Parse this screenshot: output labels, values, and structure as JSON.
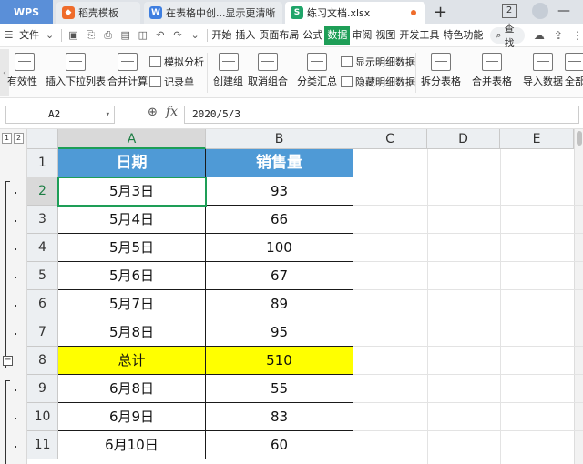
{
  "tabs": {
    "app": "WPS",
    "items": [
      {
        "label": "稻壳模板",
        "icon": "docer-icon"
      },
      {
        "label": "在表格中创...显示更清晰",
        "icon": "writer-doc-icon"
      },
      {
        "label": "练习文档.xlsx",
        "icon": "spreadsheet-icon"
      }
    ],
    "new_tab": "+",
    "window_count": "2"
  },
  "menu": {
    "file": "文件",
    "items": [
      "开始",
      "插入",
      "页面布局",
      "公式",
      "数据",
      "审阅",
      "视图",
      "开发工具",
      "特色功能"
    ],
    "active": "数据",
    "search": "查找"
  },
  "ribbon": {
    "validity": "有效性",
    "insert_dropdown": "插入下拉列表",
    "merge_calc": "合并计算",
    "simulate": "模拟分析",
    "record": "记录单",
    "create_group": "创建组",
    "ungroup": "取消组合",
    "subtotal": "分类汇总",
    "show_detail": "显示明细数据",
    "hide_detail": "隐藏明细数据",
    "split_table": "拆分表格",
    "merge_table": "合并表格",
    "import_data": "导入数据",
    "all": "全部"
  },
  "formula_bar": {
    "cell_ref": "A2",
    "fx": "fx",
    "value": "2020/5/3"
  },
  "sheet": {
    "outline_levels": [
      "1",
      "2"
    ],
    "columns": [
      "A",
      "B",
      "C",
      "D",
      "E"
    ],
    "rows": [
      "1",
      "2",
      "3",
      "4",
      "5",
      "6",
      "7",
      "8",
      "9",
      "10",
      "11"
    ],
    "header": {
      "date": "日期",
      "sales": "销售量"
    },
    "data": [
      {
        "date": "5月3日",
        "sales": "93"
      },
      {
        "date": "5月4日",
        "sales": "66"
      },
      {
        "date": "5月5日",
        "sales": "100"
      },
      {
        "date": "5月6日",
        "sales": "67"
      },
      {
        "date": "5月7日",
        "sales": "89"
      },
      {
        "date": "5月8日",
        "sales": "95"
      },
      {
        "date": "总计",
        "sales": "510"
      },
      {
        "date": "6月8日",
        "sales": "55"
      },
      {
        "date": "6月9日",
        "sales": "83"
      },
      {
        "date": "6月10日",
        "sales": "60"
      }
    ],
    "total_color": "#ffff00",
    "header_color": "#4f9ad6",
    "accent": "#1e9e57"
  }
}
